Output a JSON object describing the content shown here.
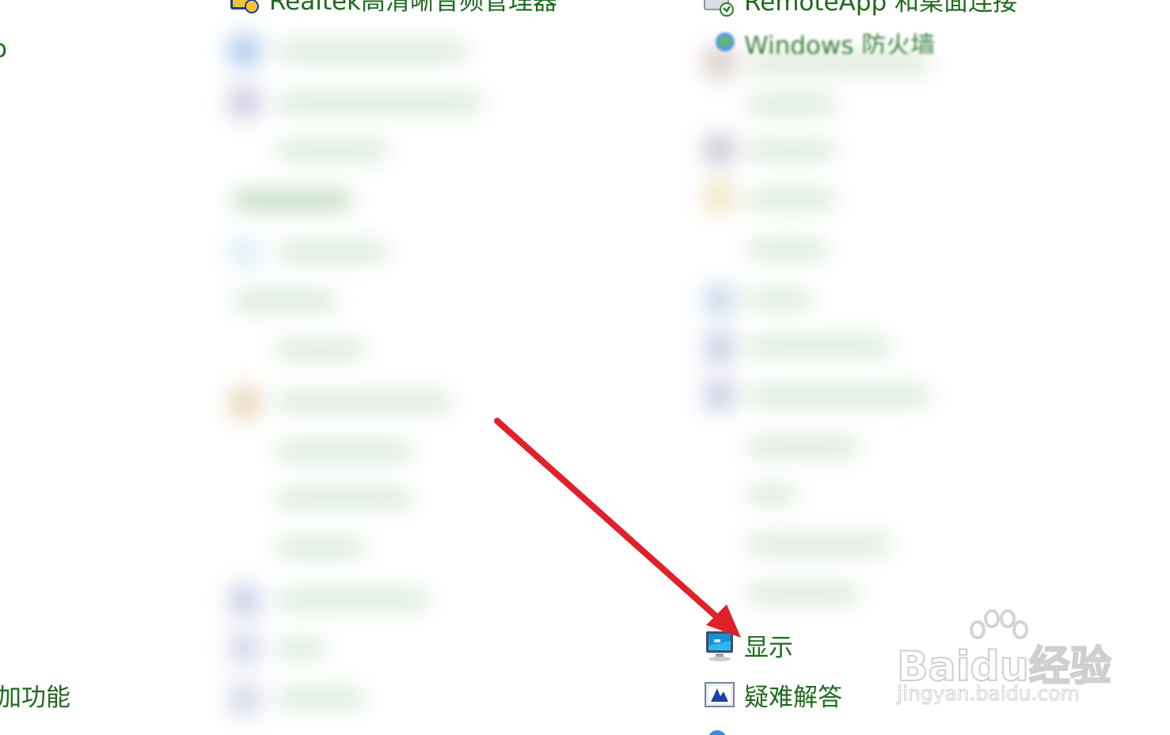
{
  "left_edge": {
    "fragment_top": "o",
    "fragment_bottom": "加功能"
  },
  "items": {
    "realtek": {
      "label": "Realtek高清晰音频管理器",
      "icon": "realtek-audio-icon"
    },
    "remoteapp": {
      "label": "RemoteApp 和桌面连接",
      "icon": "remote-desktop-icon"
    },
    "windows_partial": {
      "label": "Windows 防火墙",
      "icon": "globe-icon"
    },
    "display": {
      "label": "显示",
      "icon": "monitor-icon"
    },
    "troubleshoot": {
      "label": "疑难解答",
      "icon": "troubleshoot-icon"
    }
  },
  "watermark": {
    "brand": "Baidu经验",
    "url": "jingyan.baidu.com"
  },
  "colors": {
    "link": "#1e6a1e",
    "arrow": "#e0202a",
    "blur_tint": "#cfe3cf",
    "watermark": "#cfcfcf"
  }
}
